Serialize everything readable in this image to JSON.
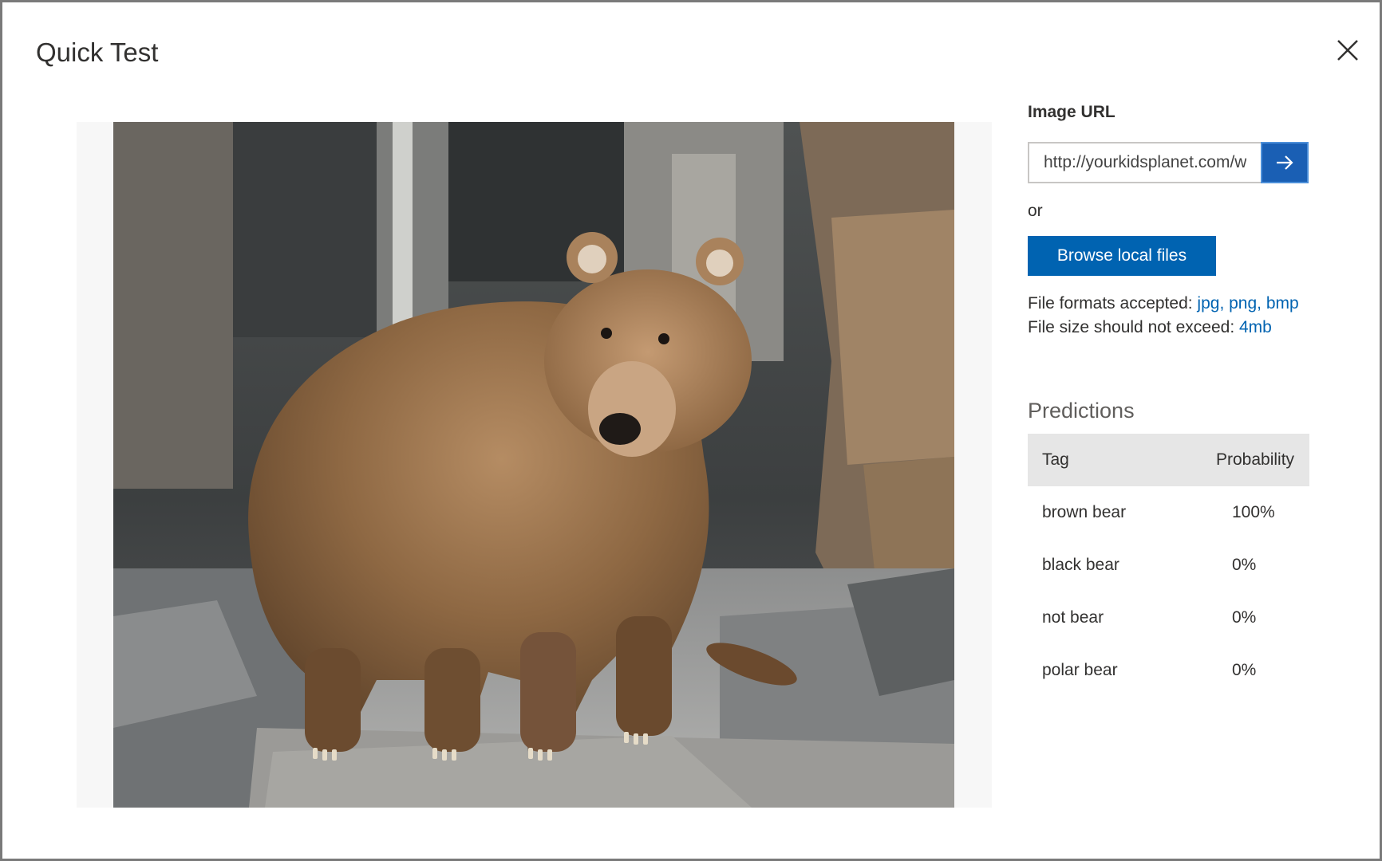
{
  "dialog": {
    "title": "Quick Test",
    "close_icon": "close-icon"
  },
  "image": {
    "subject_icon": "brown-bear-photo"
  },
  "url_section": {
    "label": "Image URL",
    "input_value": "http://yourkidsplanet.com/w",
    "go_icon": "arrow-right-icon"
  },
  "or_text": "or",
  "browse": {
    "label": "Browse local files"
  },
  "file_info": {
    "formats_label": "File formats accepted: ",
    "formats_value": "jpg, png, bmp",
    "size_label": "File size should not exceed: ",
    "size_value": "4mb"
  },
  "predictions": {
    "heading": "Predictions",
    "columns": [
      "Tag",
      "Probability"
    ],
    "rows": [
      {
        "tag": "brown bear",
        "probability": "100%"
      },
      {
        "tag": "black bear",
        "probability": "0%"
      },
      {
        "tag": "not bear",
        "probability": "0%"
      },
      {
        "tag": "polar bear",
        "probability": "0%"
      }
    ]
  },
  "colors": {
    "accent": "#0063b1",
    "border": "#7a7a7a",
    "table_header": "#e6e6e6"
  }
}
